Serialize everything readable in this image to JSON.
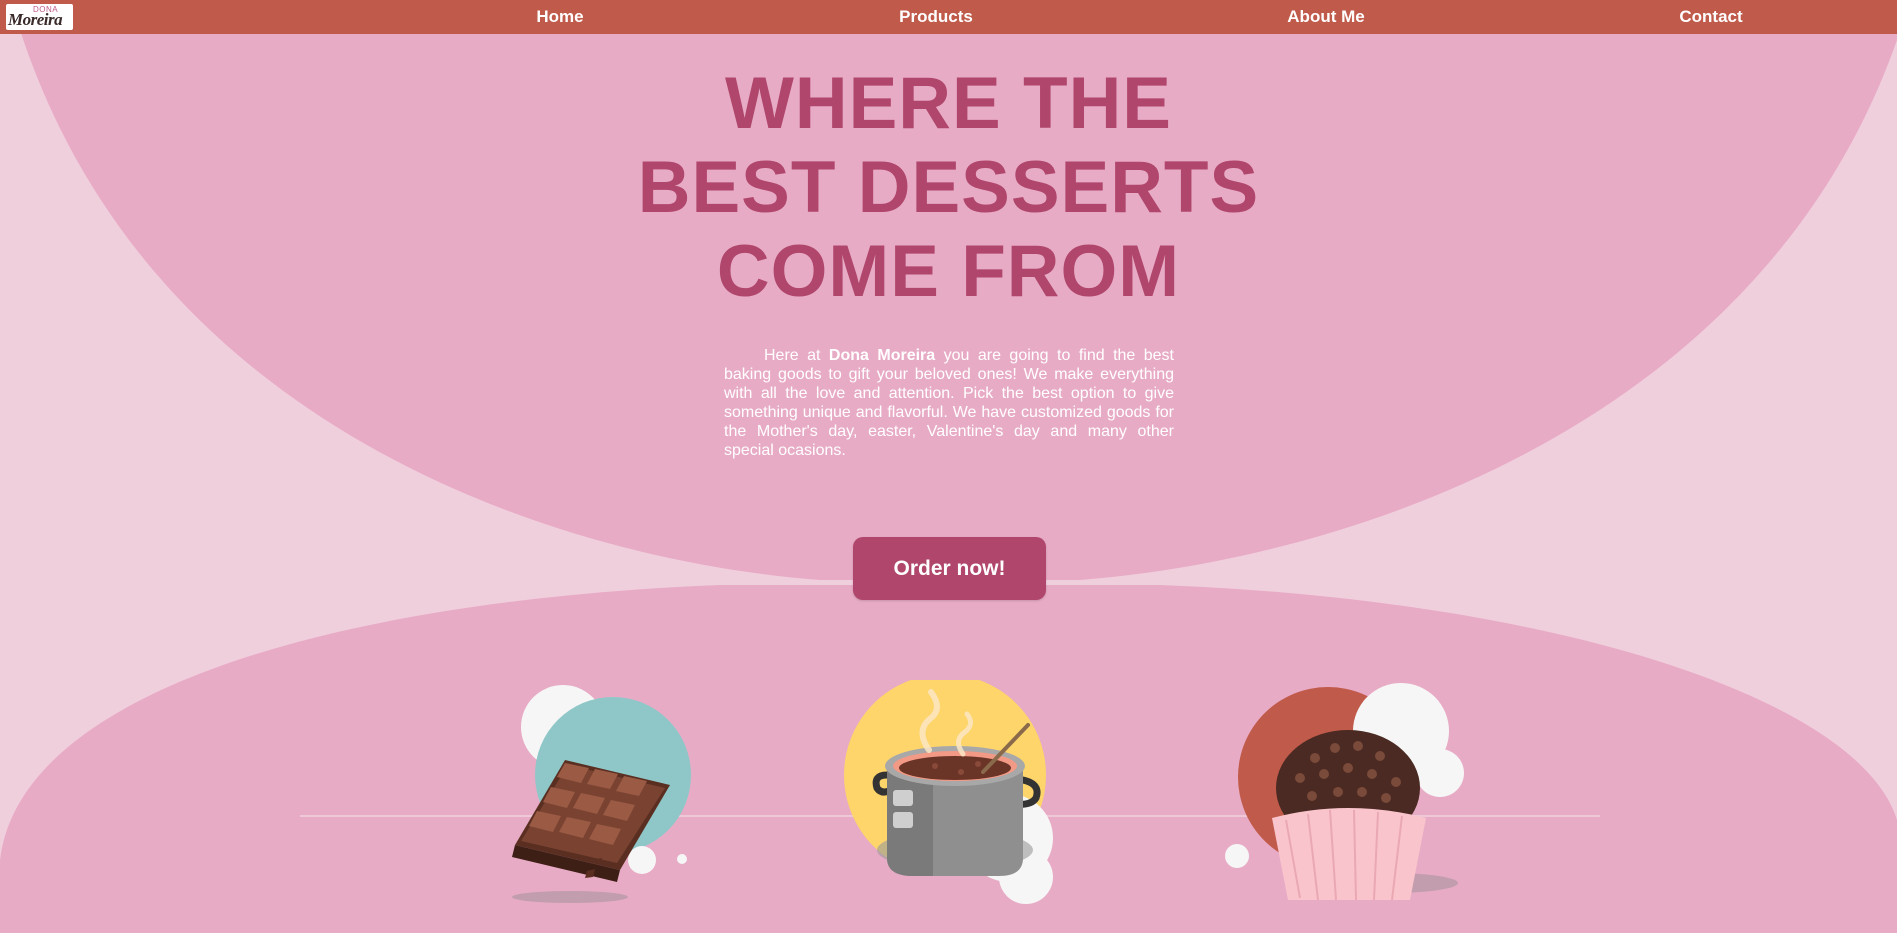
{
  "logo": {
    "top_text": "DONA",
    "script_text": "Moreira"
  },
  "nav": {
    "home": "Home",
    "products": "Products",
    "about": "About Me",
    "contact": "Contact"
  },
  "hero": {
    "title_line1": "WHERE THE",
    "title_line2": "BEST DESSERTS",
    "title_line3": "COME FROM",
    "text_before": "Here at ",
    "brand_name": "Dona Moreira",
    "text_after": " you are going to find the best baking goods to gift your beloved ones! We make everything with all the love and attention. Pick the best option to give something unique and flavorful. We have customized goods for the Mother's day, easter, Valentine's day and many other special ocasions.",
    "cta_label": "Order now!"
  },
  "illustrations": [
    "chocolate-bar-icon",
    "cooking-pot-icon",
    "cupcake-icon"
  ],
  "colors": {
    "navbar": "#c05a4a",
    "background_light": "#f0cfdd",
    "background_blob": "#e8abc5",
    "title": "#b0466b",
    "button": "#b0466b"
  }
}
